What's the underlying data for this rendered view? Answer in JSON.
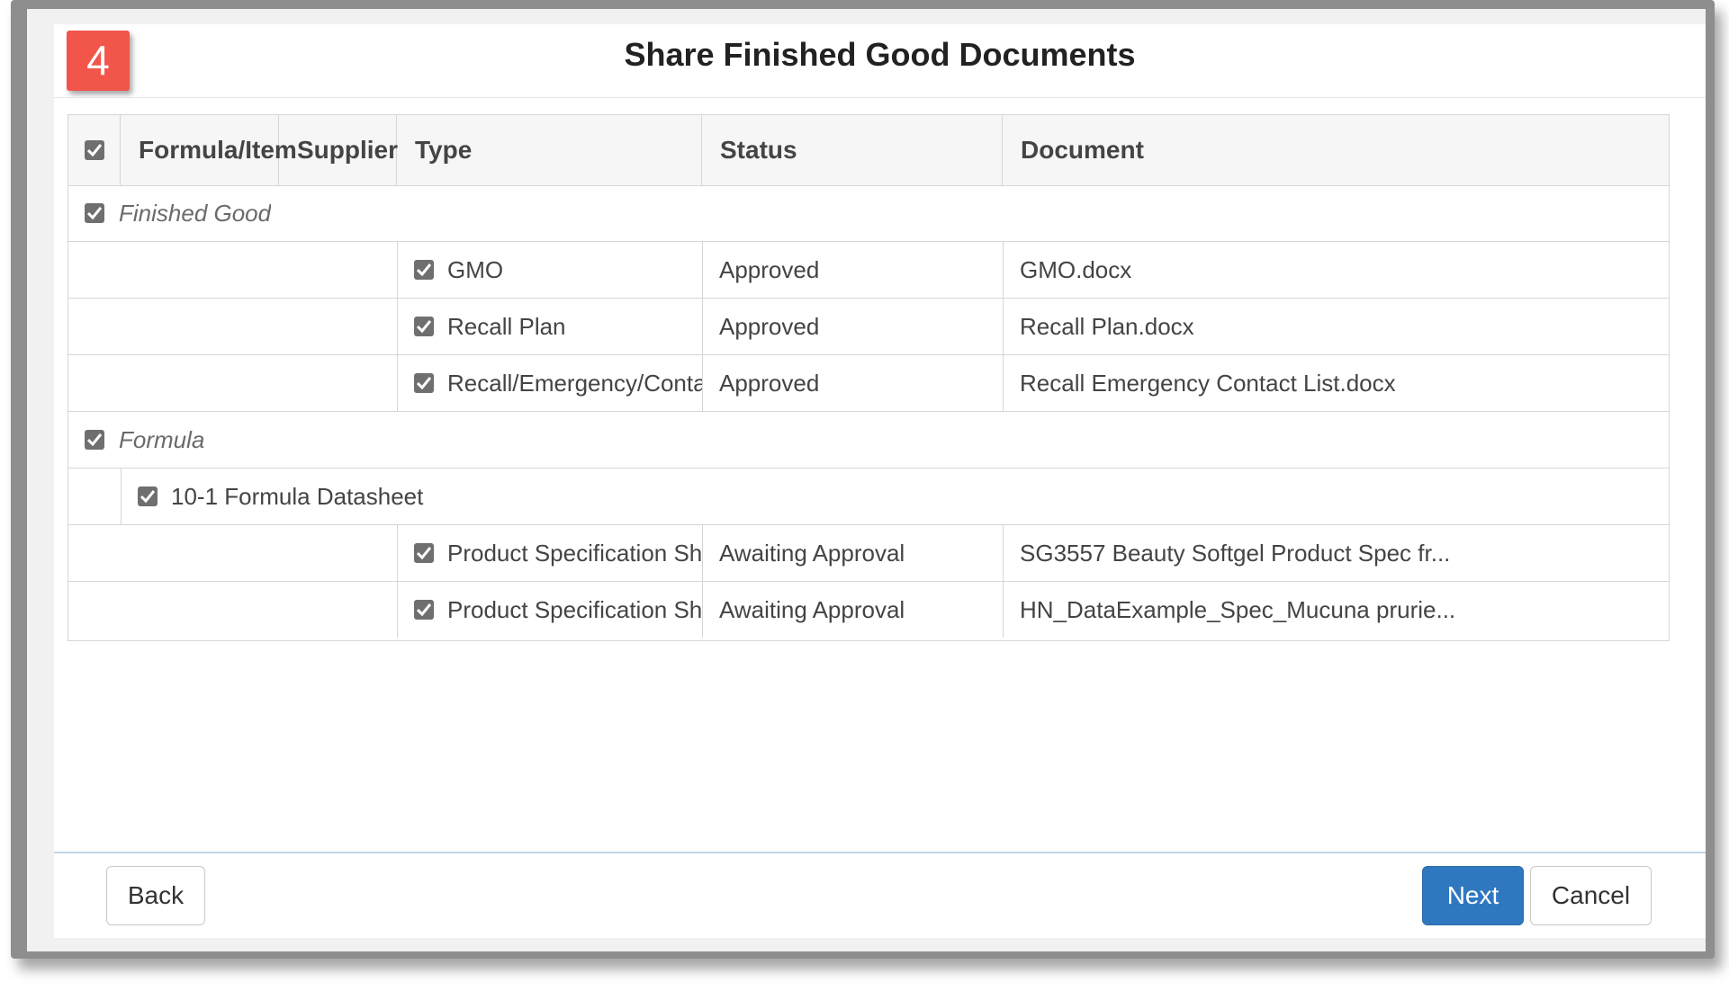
{
  "step_badge": "4",
  "title": "Share Finished Good Documents",
  "columns": [
    "Formula/Item",
    "Supplier",
    "Type",
    "Status",
    "Document"
  ],
  "groups": {
    "finished_good": {
      "label": "Finished Good",
      "rows": [
        {
          "type": "GMO",
          "status": "Approved",
          "document": "GMO.docx"
        },
        {
          "type": "Recall Plan",
          "status": "Approved",
          "document": "Recall Plan.docx"
        },
        {
          "type": "Recall/Emergency/Contact List",
          "status": "Approved",
          "document": "Recall Emergency Contact List.docx"
        }
      ]
    },
    "formula": {
      "label": "Formula",
      "subgroup_label": "10-1 Formula Datasheet",
      "rows": [
        {
          "type": "Product Specification Sheet",
          "status": "Awaiting Approval",
          "document": "SG3557 Beauty Softgel Product Spec fr..."
        },
        {
          "type": "Product Specification Sheet",
          "status": "Awaiting Approval",
          "document": "HN_DataExample_Spec_Mucuna prurie..."
        }
      ]
    }
  },
  "buttons": {
    "back": "Back",
    "next": "Next",
    "cancel": "Cancel"
  },
  "colors": {
    "badge": "#f2554a",
    "primary": "#2f78c0",
    "checkbox": "#6f6f6f"
  },
  "icons": {
    "checkbox": "checkbox-checked-icon"
  }
}
